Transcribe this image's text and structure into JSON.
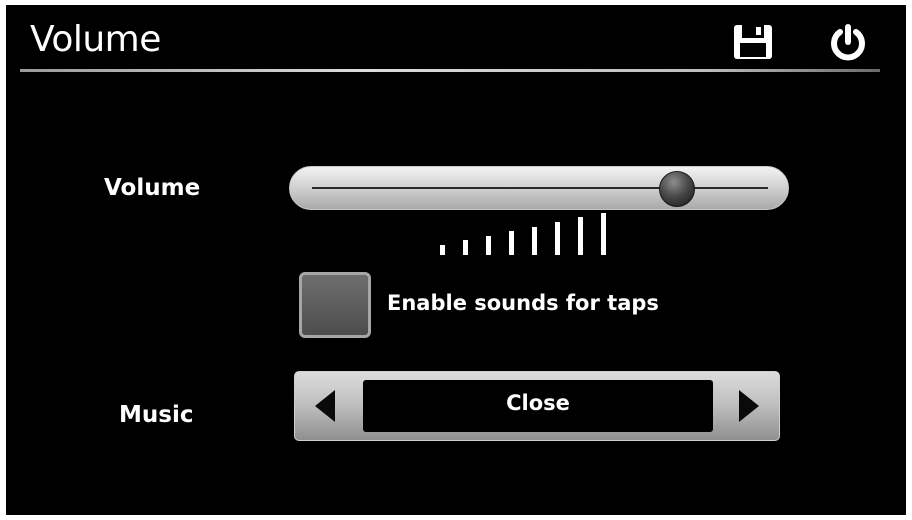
{
  "header": {
    "title": "Volume",
    "icons": [
      "save-icon",
      "power-icon"
    ]
  },
  "volume": {
    "label": "Volume",
    "slider_value_fraction": 0.8,
    "level_bars_count": 8
  },
  "tap_sounds": {
    "label": "Enable sounds for taps",
    "checked": false
  },
  "music": {
    "label": "Music",
    "selected_value": "Close"
  },
  "colors": {
    "background": "#000000",
    "text": "#ffffff",
    "control_gray": "#bdbdbd"
  }
}
